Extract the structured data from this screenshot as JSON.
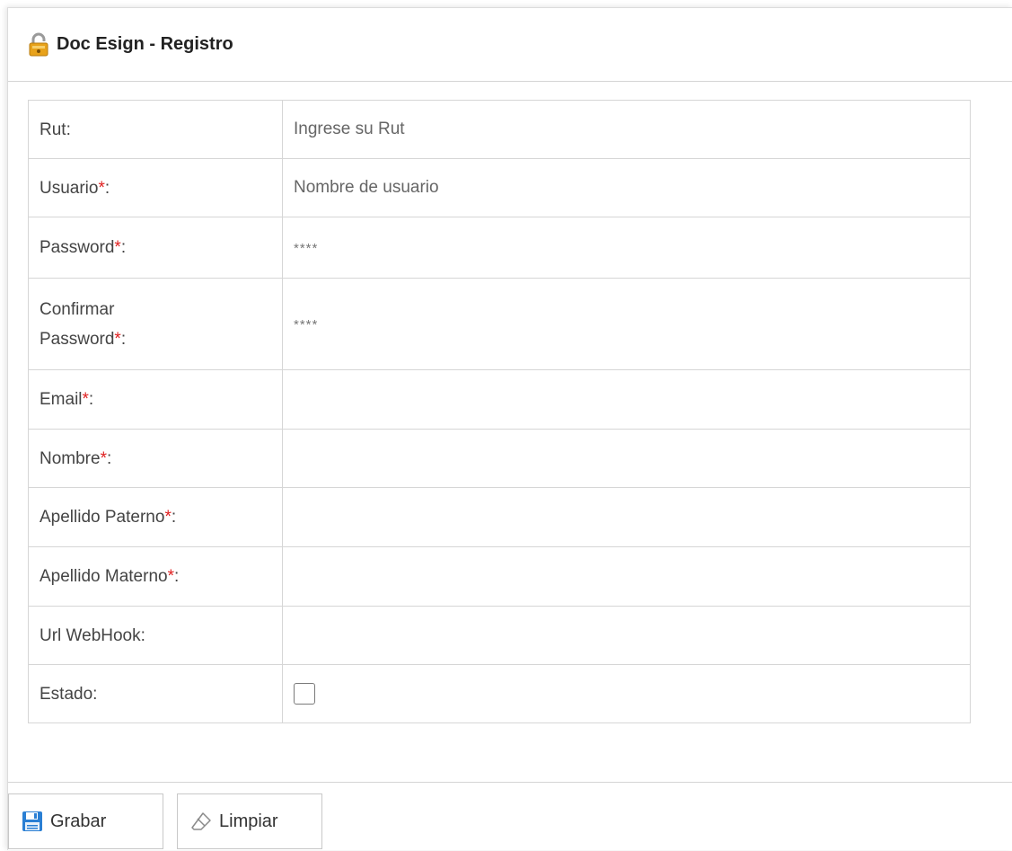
{
  "panel": {
    "title": "Doc Esign - Registro"
  },
  "form": {
    "rows": [
      {
        "label": "Rut",
        "required": false,
        "value": "Ingrese su Rut"
      },
      {
        "label": "Usuario",
        "required": true,
        "value": "Nombre de usuario"
      },
      {
        "label": "Password",
        "required": true,
        "value": "****"
      },
      {
        "label": "Confirmar",
        "label2": "Password",
        "required": true,
        "value": "****"
      },
      {
        "label": "Email",
        "required": true,
        "value": ""
      },
      {
        "label": "Nombre",
        "required": true,
        "value": ""
      },
      {
        "label": "Apellido Paterno",
        "required": true,
        "value": ""
      },
      {
        "label": "Apellido Materno",
        "required": true,
        "value": ""
      },
      {
        "label": "Url WebHook",
        "required": false,
        "value": ""
      },
      {
        "label": "Estado",
        "required": false,
        "checked": false
      }
    ],
    "required_mark": "*",
    "colon": ":"
  },
  "footer": {
    "save_label": "Grabar",
    "clear_label": "Limpiar"
  },
  "icons": {
    "title_icon": "lock-icon",
    "save_icon": "floppy-disk-icon",
    "clear_icon": "eraser-icon"
  },
  "colors": {
    "required": "#e02020",
    "save_icon": "#2a7fd4",
    "lock_icon": "#e8a21a"
  }
}
